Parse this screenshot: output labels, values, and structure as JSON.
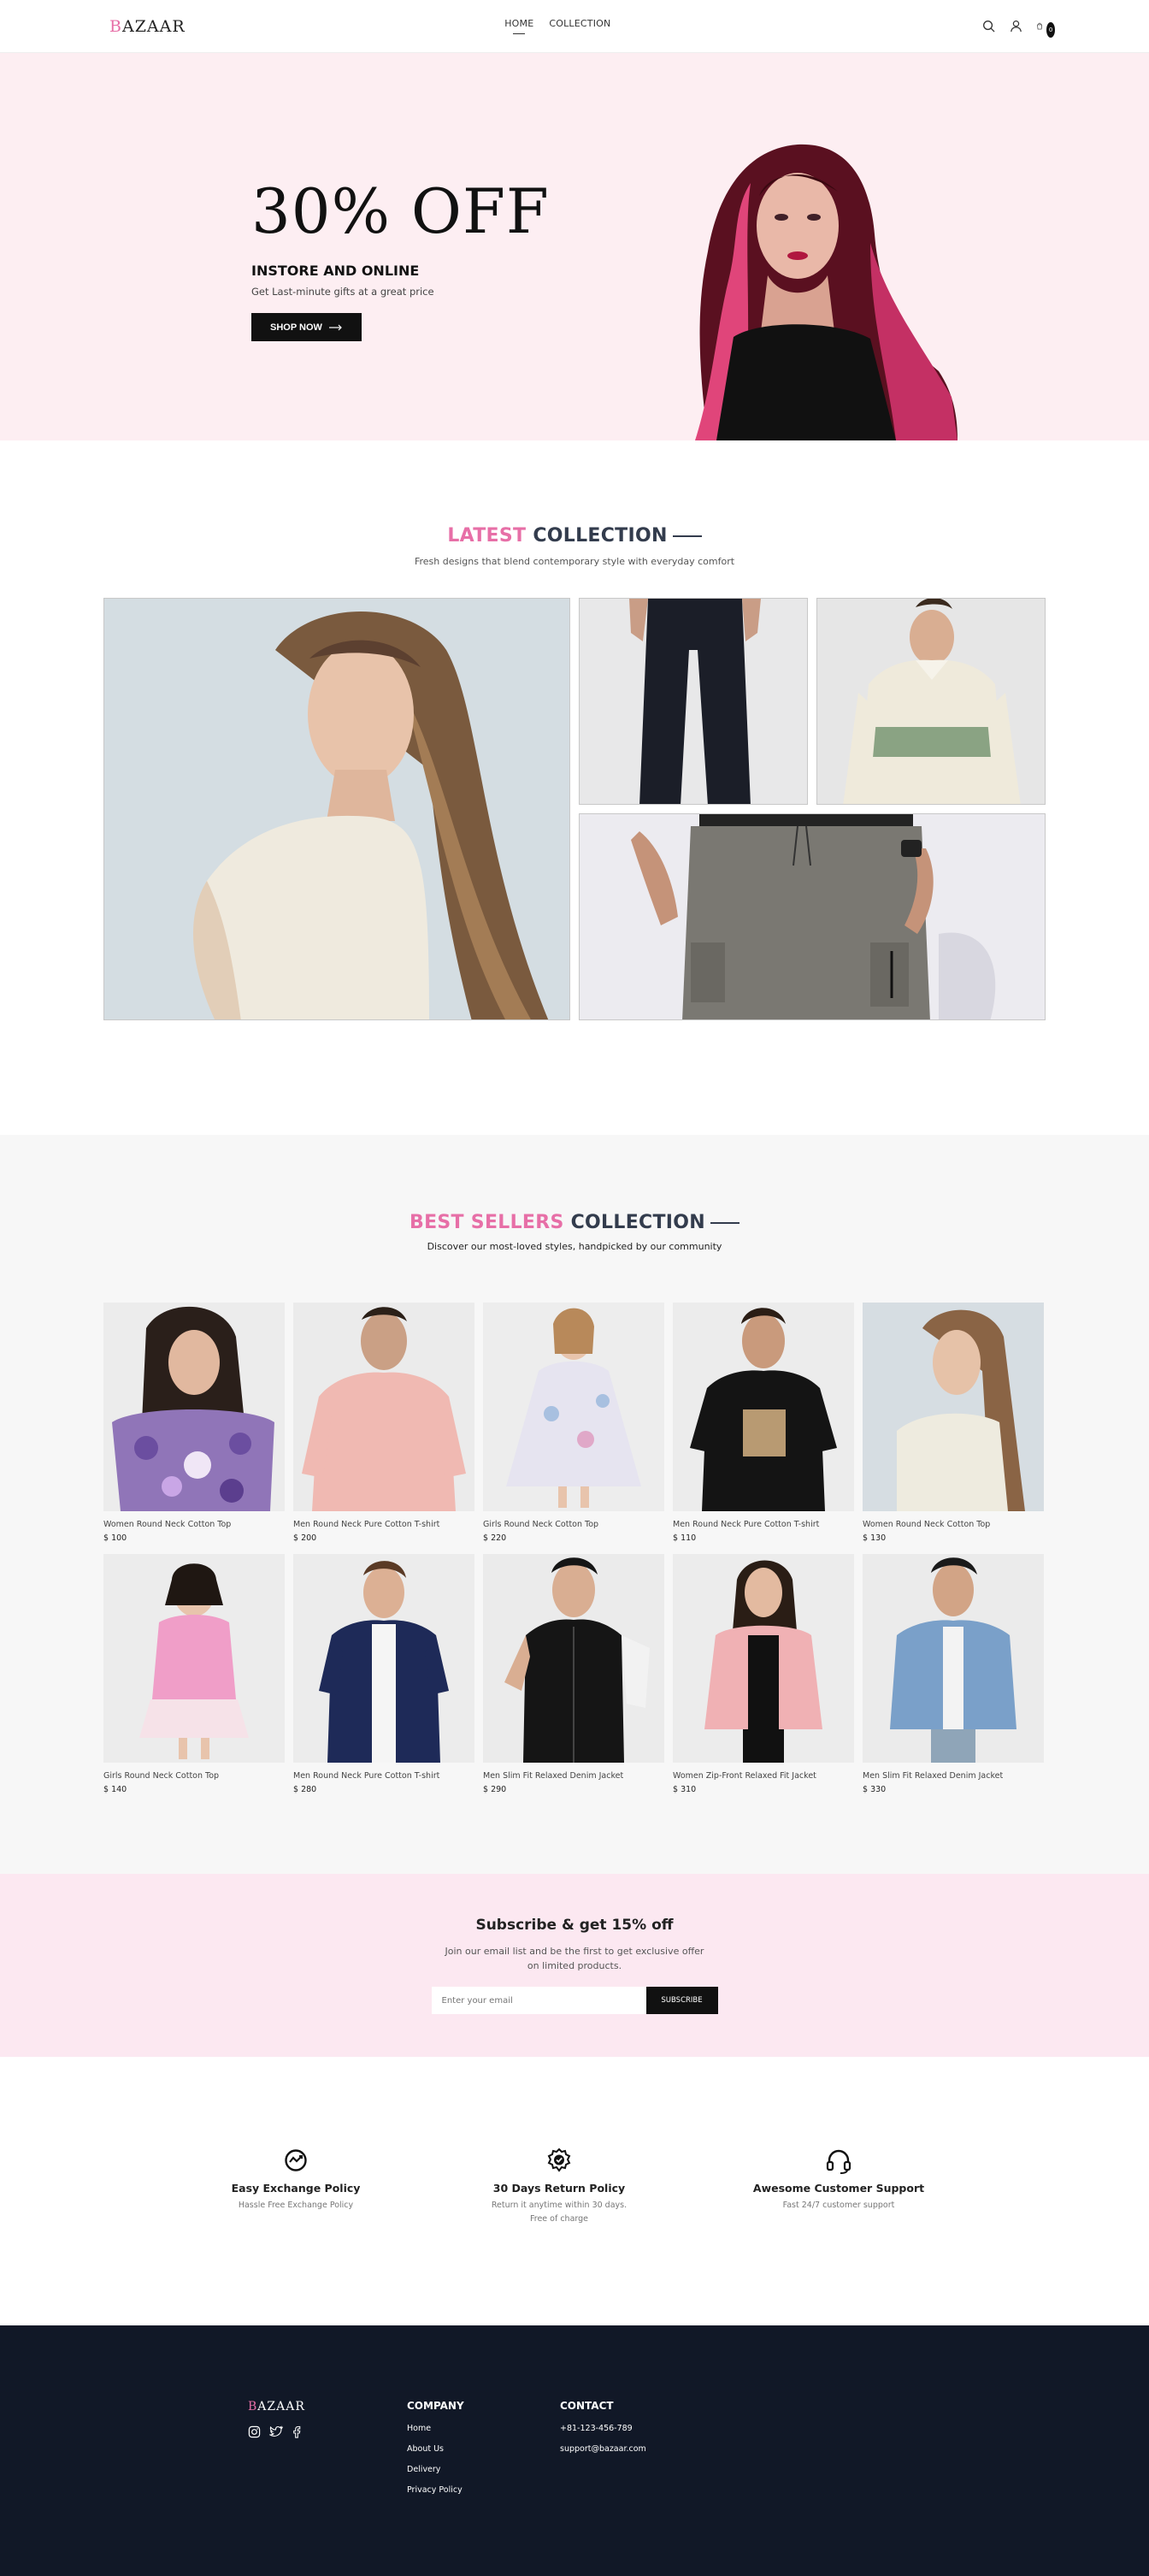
{
  "header": {
    "logo_first": "B",
    "logo_rest": "AZAAR",
    "nav": [
      "HOME",
      "COLLECTION"
    ],
    "cart_count": "0"
  },
  "hero": {
    "title": "30% OFF",
    "subtitle": "INSTORE AND ONLINE",
    "description": "Get Last-minute gifts at a great price",
    "button": "SHOP NOW"
  },
  "latest": {
    "title_pink": "LATEST",
    "title_dark": "COLLECTION",
    "description": "Fresh designs that blend contemporary style with everyday comfort"
  },
  "best": {
    "title_pink": "BEST SELLERS",
    "title_dark": "COLLECTION",
    "description": "Discover our most-loved styles, handpicked by our community",
    "products": [
      {
        "name": "Women Round Neck Cotton Top",
        "price": "$ 100"
      },
      {
        "name": "Men Round Neck Pure Cotton T-shirt",
        "price": "$ 200"
      },
      {
        "name": "Girls Round Neck Cotton Top",
        "price": "$ 220"
      },
      {
        "name": "Men Round Neck Pure Cotton T-shirt",
        "price": "$ 110"
      },
      {
        "name": "Women Round Neck Cotton Top",
        "price": "$ 130"
      },
      {
        "name": "Girls Round Neck Cotton Top",
        "price": "$ 140"
      },
      {
        "name": "Men Round Neck Pure Cotton T-shirt",
        "price": "$ 280"
      },
      {
        "name": "Men Slim Fit Relaxed Denim Jacket",
        "price": "$ 290"
      },
      {
        "name": "Women Zip-Front Relaxed Fit Jacket",
        "price": "$ 310"
      },
      {
        "name": "Men Slim Fit Relaxed Denim Jacket",
        "price": "$ 330"
      }
    ]
  },
  "subscribe": {
    "title": "Subscribe & get 15% off",
    "line1": "Join our email list and be the first to get exclusive offer",
    "line2": "on limited products.",
    "placeholder": "Enter your email",
    "button": "SUBSCRIBE"
  },
  "policies": [
    {
      "title": "Easy Exchange Policy",
      "line1": "Hassle Free Exchange Policy",
      "line2": ""
    },
    {
      "title": "30 Days Return Policy",
      "line1": "Return it anytime within 30 days.",
      "line2": "Free of charge"
    },
    {
      "title": "Awesome Customer Support",
      "line1": "Fast 24/7 customer support",
      "line2": ""
    }
  ],
  "footer": {
    "logo_first": "B",
    "logo_rest": "AZAAR",
    "company_title": "COMPANY",
    "company_links": [
      "Home",
      "About Us",
      "Delivery",
      "Privacy Policy"
    ],
    "contact_title": "CONTACT",
    "phone": "+81-123-456-789",
    "email": "support@bazaar.com"
  },
  "colors": {
    "accent": "#e76fa7",
    "dark": "#111827",
    "hero_bg": "#fdeef2",
    "subscribe_bg": "#fce8f1"
  }
}
